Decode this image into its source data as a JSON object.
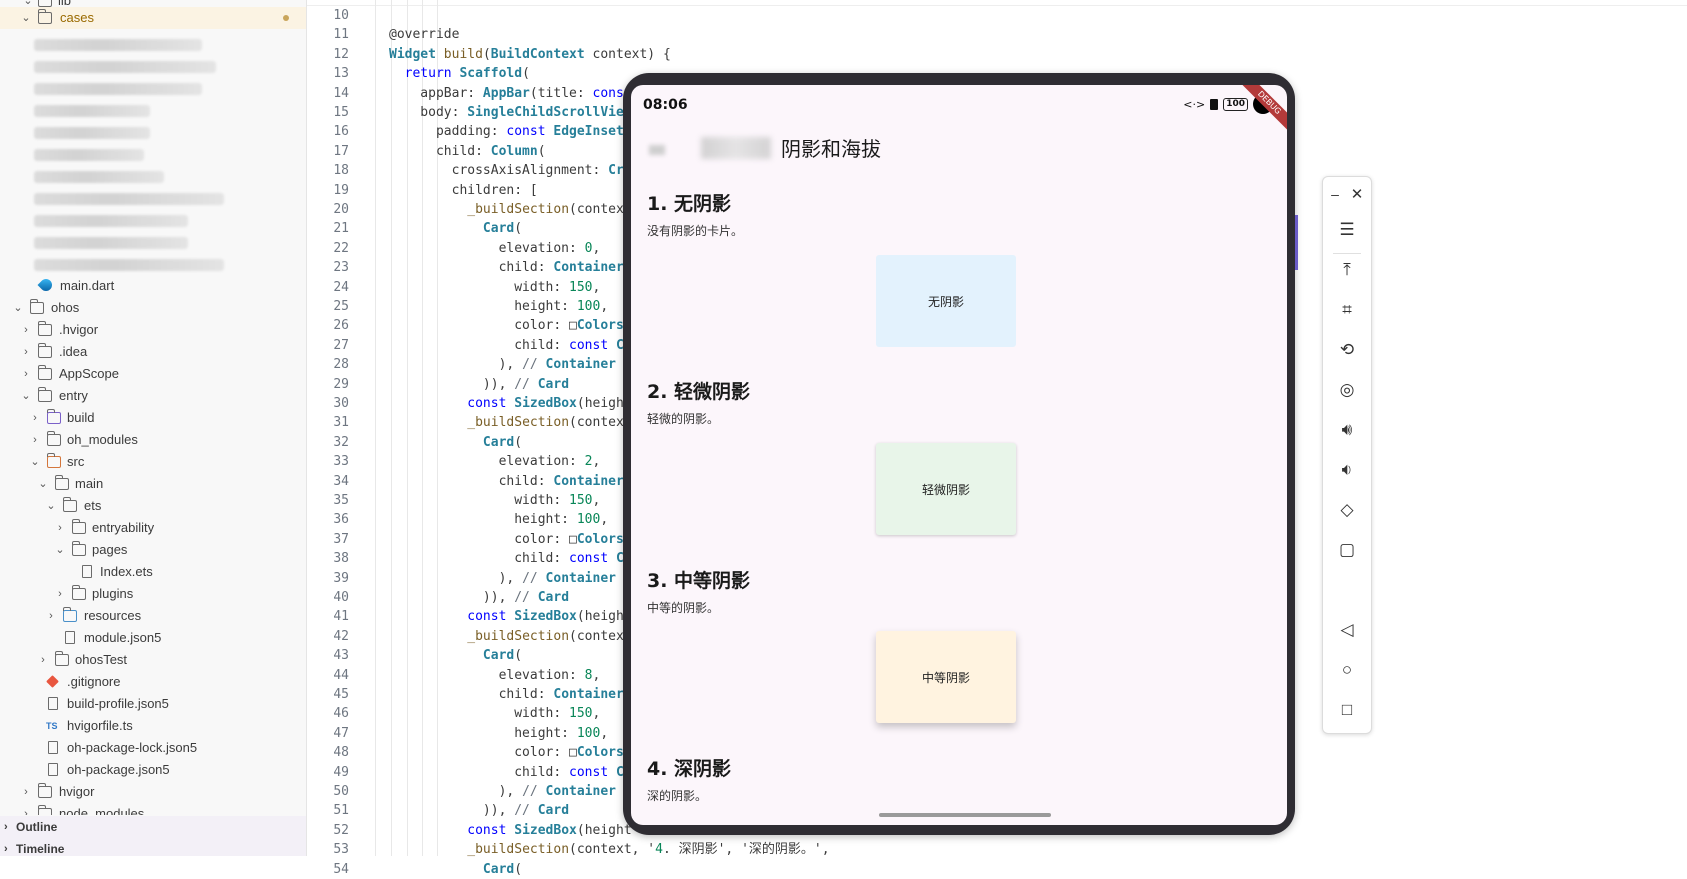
{
  "explorer": {
    "top_partial": "lib",
    "cases_label": "cases",
    "main_dart": "main.dart",
    "ohos": "ohos",
    "hvigor_dir": ".hvigor",
    "idea": ".idea",
    "appscope": "AppScope",
    "entry": "entry",
    "build": "build",
    "oh_modules": "oh_modules",
    "src": "src",
    "main": "main",
    "ets": "ets",
    "entryability": "entryability",
    "pages": "pages",
    "index_ets": "Index.ets",
    "plugins": "plugins",
    "resources": "resources",
    "module_json5": "module.json5",
    "ohostest": "ohosTest",
    "gitignore": ".gitignore",
    "build_profile": "build-profile.json5",
    "hvigorfile": "hvigorfile.ts",
    "ts_badge": "TS",
    "oh_package_lock": "oh-package-lock.json5",
    "oh_package": "oh-package.json5",
    "hvigor": "hvigor",
    "node_modules": "node_modules",
    "outline": "Outline",
    "timeline": "Timeline"
  },
  "editor": {
    "lines": [
      {
        "n": "10",
        "code": ""
      },
      {
        "n": "11",
        "code": "@override"
      },
      {
        "n": "12",
        "code": "Widget build(BuildContext context) {"
      },
      {
        "n": "13",
        "code": "  return Scaffold("
      },
      {
        "n": "14",
        "code": "    appBar: AppBar(title: const"
      },
      {
        "n": "15",
        "code": "    body: SingleChildScrollView"
      },
      {
        "n": "16",
        "code": "      padding: const EdgeInsets"
      },
      {
        "n": "17",
        "code": "      child: Column("
      },
      {
        "n": "18",
        "code": "        crossAxisAlignment: Cro"
      },
      {
        "n": "19",
        "code": "        children: ["
      },
      {
        "n": "20",
        "code": "          _buildSection(context"
      },
      {
        "n": "21",
        "code": "            Card("
      },
      {
        "n": "22",
        "code": "              elevation: 0,"
      },
      {
        "n": "23",
        "code": "              child: Container"
      },
      {
        "n": "24",
        "code": "                width: 150,"
      },
      {
        "n": "25",
        "code": "                height: 100,"
      },
      {
        "n": "26",
        "code": "                color: □Colors"
      },
      {
        "n": "27",
        "code": "                child: const Ce"
      },
      {
        "n": "28",
        "code": "              ), // Container"
      },
      {
        "n": "29",
        "code": "            )), // Card"
      },
      {
        "n": "30",
        "code": "          const SizedBox(height"
      },
      {
        "n": "31",
        "code": "          _buildSection(context"
      },
      {
        "n": "32",
        "code": "            Card("
      },
      {
        "n": "33",
        "code": "              elevation: 2,"
      },
      {
        "n": "34",
        "code": "              child: Container"
      },
      {
        "n": "35",
        "code": "                width: 150,"
      },
      {
        "n": "36",
        "code": "                height: 100,"
      },
      {
        "n": "37",
        "code": "                color: □Colors"
      },
      {
        "n": "38",
        "code": "                child: const Ce"
      },
      {
        "n": "39",
        "code": "              ), // Container"
      },
      {
        "n": "40",
        "code": "            )), // Card"
      },
      {
        "n": "41",
        "code": "          const SizedBox(height"
      },
      {
        "n": "42",
        "code": "          _buildSection(context"
      },
      {
        "n": "43",
        "code": "            Card("
      },
      {
        "n": "44",
        "code": "              elevation: 8,"
      },
      {
        "n": "45",
        "code": "              child: Container"
      },
      {
        "n": "46",
        "code": "                width: 150,"
      },
      {
        "n": "47",
        "code": "                height: 100,"
      },
      {
        "n": "48",
        "code": "                color: □Colors"
      },
      {
        "n": "49",
        "code": "                child: const Ce"
      },
      {
        "n": "50",
        "code": "              ), // Container"
      },
      {
        "n": "51",
        "code": "            )), // Card"
      },
      {
        "n": "52",
        "code": "          const SizedBox(height"
      },
      {
        "n": "53",
        "code": "          _buildSection(context, '4. 深阴影', '深的阴影。',"
      },
      {
        "n": "54",
        "code": "            Card("
      }
    ]
  },
  "device": {
    "time": "08:06",
    "battery": "100",
    "debug_label": "DEBUG",
    "app_title": "阴影和海拔",
    "sections": [
      {
        "title": "1. 无阴影",
        "desc": "没有阴影的卡片。",
        "card_label": "无阴影",
        "card_color": "#e3f2fd"
      },
      {
        "title": "2. 轻微阴影",
        "desc": "轻微的阴影。",
        "card_label": "轻微阴影",
        "card_color": "#e8f5e9"
      },
      {
        "title": "3. 中等阴影",
        "desc": "中等的阴影。",
        "card_label": "中等阴影",
        "card_color": "#fff3e0"
      },
      {
        "title": "4. 深阴影",
        "desc": "深的阴影。"
      }
    ]
  },
  "toolbar_icons": [
    "minimize-icon",
    "close-icon",
    "menu-icon",
    "pin-top-icon",
    "crop-icon",
    "rotate-icon",
    "screenshot-icon",
    "volume-up-icon",
    "volume-down-icon",
    "fold-icon",
    "fullscreen-icon",
    "back-icon",
    "home-icon",
    "recents-icon"
  ]
}
